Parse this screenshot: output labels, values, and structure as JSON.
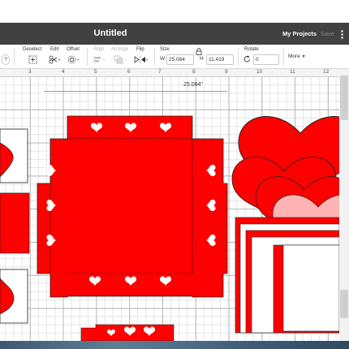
{
  "app": {
    "document_title": "Untitled",
    "my_projects_label": "My Projects",
    "save_label": "Save"
  },
  "toolbar": {
    "help_icon_text": "?",
    "deselect_label": "Deselect",
    "edit_label": "Edit",
    "offset_label": "Offset",
    "align_label": "Align",
    "arrange_label": "Arrange",
    "flip_label": "Flip",
    "size_label": "Size",
    "width_prefix": "W",
    "width_value": "25.084",
    "height_prefix": "H",
    "height_value": "11.419",
    "rotate_label": "Rotate",
    "rotate_value": "0",
    "more_label": "More"
  },
  "ruler": {
    "ticks": [
      "3",
      "4",
      "5",
      "6",
      "7",
      "8",
      "9",
      "10",
      "11",
      "12"
    ]
  },
  "canvas": {
    "selection_width_label": "25.084\"",
    "colors": {
      "red": "#ff0000",
      "pink": "#ffb3b3",
      "white": "#ffffff",
      "titlebar": "#414141"
    }
  }
}
